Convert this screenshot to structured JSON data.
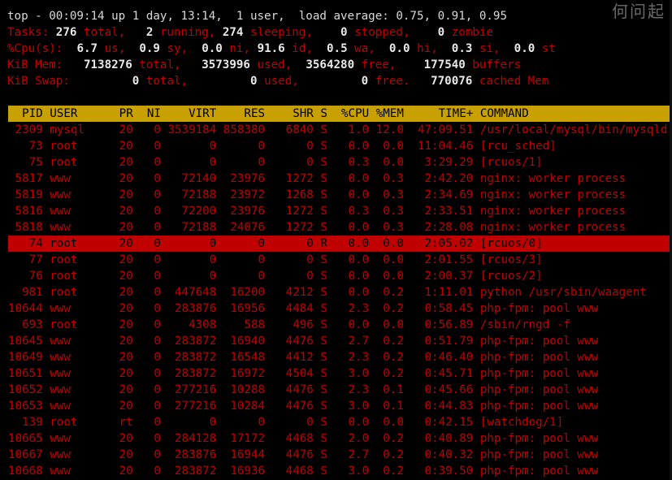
{
  "watermark": "何问起",
  "summary": {
    "top_line": "top - 00:09:14 up 1 day, 13:14,  1 user,  load average: 0.75, 0.91, 0.95",
    "tasks": {
      "label": "Tasks:",
      "total": "276",
      "total_label": "total,",
      "running": "2",
      "running_label": "running,",
      "sleeping": "274",
      "sleeping_label": "sleeping,",
      "stopped": "0",
      "stopped_label": "stopped,",
      "zombie": "0",
      "zombie_label": "zombie"
    },
    "cpu": {
      "label": "%Cpu(s):",
      "us": "6.7",
      "us_label": "us,",
      "sy": "0.9",
      "sy_label": "sy,",
      "ni": "0.0",
      "ni_label": "ni,",
      "id": "91.6",
      "id_label": "id,",
      "wa": "0.5",
      "wa_label": "wa,",
      "hi": "0.0",
      "hi_label": "hi,",
      "si": "0.3",
      "si_label": "si,",
      "st": "0.0",
      "st_label": "st"
    },
    "mem": {
      "label": "KiB Mem:",
      "total": "7138276",
      "total_label": "total,",
      "used": "3573996",
      "used_label": "used,",
      "free": "3564280",
      "free_label": "free,",
      "buffers": "177540",
      "buffers_label": "buffers"
    },
    "swap": {
      "label": "KiB Swap:",
      "total": "0",
      "total_label": "total,",
      "used": "0",
      "used_label": "used,",
      "free": "0",
      "free_label": "free.",
      "cached": "770076",
      "cached_label": "cached Mem"
    }
  },
  "table": {
    "header": "  PID USER      PR  NI    VIRT    RES    SHR S  %CPU %MEM     TIME+ COMMAND",
    "selected_index": 7,
    "rows": [
      " 2309 mysql     20   0 3539184 858380   6840 S   1.0 12.0  47:09.51 /usr/local/mysql/bin/mysqld",
      "   73 root      20   0       0      0      0 S   0.0  0.0  11:04.46 [rcu_sched]",
      "   75 root      20   0       0      0      0 S   0.3  0.0   3:29.29 [rcuos/1]",
      " 5817 www       20   0   72140  23976   1272 S   0.0  0.3   2:42.20 nginx: worker process",
      " 5819 www       20   0   72188  23972   1268 S   0.0  0.3   2:34.69 nginx: worker process",
      " 5816 www       20   0   72200  23976   1272 S   0.3  0.3   2:33.51 nginx: worker process",
      " 5818 www       20   0   72188  24076   1272 S   0.0  0.3   2:28.08 nginx: worker process",
      "   74 root      20   0       0      0      0 R   0.0  0.0   2:05.02 [rcuos/0]",
      "   77 root      20   0       0      0      0 S   0.0  0.0   2:01.55 [rcuos/3]",
      "   76 root      20   0       0      0      0 S   0.0  0.0   2:00.37 [rcuos/2]",
      "  981 root      20   0  447648  16200   4212 S   0.0  0.2   1:11.01 python /usr/sbin/waagent",
      "10644 www       20   0  283876  16956   4484 S   2.3  0.2   0:58.45 php-fpm: pool www",
      "  693 root      20   0    4308    588    496 S   0.0  0.0   0:56.89 /sbin/rngd -f",
      "10645 www       20   0  283872  16940   4476 S   2.7  0.2   0:51.79 php-fpm: pool www",
      "10649 www       20   0  283872  16548   4412 S   2.3  0.2   0:46.40 php-fpm: pool www",
      "10651 www       20   0  283872  16972   4504 S   3.0  0.2   0:45.71 php-fpm: pool www",
      "10652 www       20   0  277216  10288   4476 S   2.3  0.1   0:45.66 php-fpm: pool www",
      "10653 www       20   0  277216  10284   4476 S   3.0  0.1   0:44.83 php-fpm: pool www",
      "  139 root      rt   0       0      0      0 S   0.0  0.0   0:42.15 [watchdog/1]",
      "10665 www       20   0  284128  17172   4468 S   2.0  0.2   0:40.89 php-fpm: pool www",
      "10667 www       20   0  283876  16944   4476 S   2.7  0.2   0:40.32 php-fpm: pool www",
      "10668 www       20   0  283872  16936   4468 S   3.0  0.2   0:39.50 php-fpm: pool www"
    ]
  }
}
